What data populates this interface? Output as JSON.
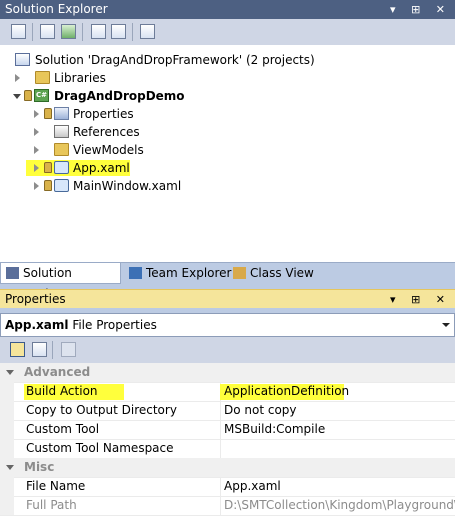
{
  "solution_explorer": {
    "title": "Solution Explorer",
    "controls": "▾ ⊞ ✕",
    "tree": {
      "solution": "Solution 'DragAndDropFramework' (2 projects)",
      "libraries": "Libraries",
      "project": "DragAndDropDemo",
      "items": [
        "Properties",
        "References",
        "ViewModels",
        "App.xaml",
        "MainWindow.xaml"
      ]
    },
    "tabs": [
      "Solution Explorer",
      "Team Explorer",
      "Class View"
    ]
  },
  "properties": {
    "title": "Properties",
    "controls": "▾ ⊞ ✕",
    "object_name": "App.xaml",
    "object_type": "File Properties",
    "categories": {
      "advanced": "Advanced",
      "misc": "Misc"
    },
    "rows": {
      "build_action": {
        "name": "Build Action",
        "value": "ApplicationDefinition"
      },
      "copy_output": {
        "name": "Copy to Output Directory",
        "value": "Do not copy"
      },
      "custom_tool": {
        "name": "Custom Tool",
        "value": "MSBuild:Compile"
      },
      "custom_tool_ns": {
        "name": "Custom Tool Namespace",
        "value": ""
      },
      "file_name": {
        "name": "File Name",
        "value": "App.xaml"
      },
      "full_path": {
        "name": "Full Path",
        "value": "D:\\SMTCollection\\Kingdom\\Playground\\sv"
      }
    }
  },
  "colors": {
    "title_inactive": "#4d6082",
    "title_active": "#f5e59b",
    "highlight": "#ffff3c"
  }
}
